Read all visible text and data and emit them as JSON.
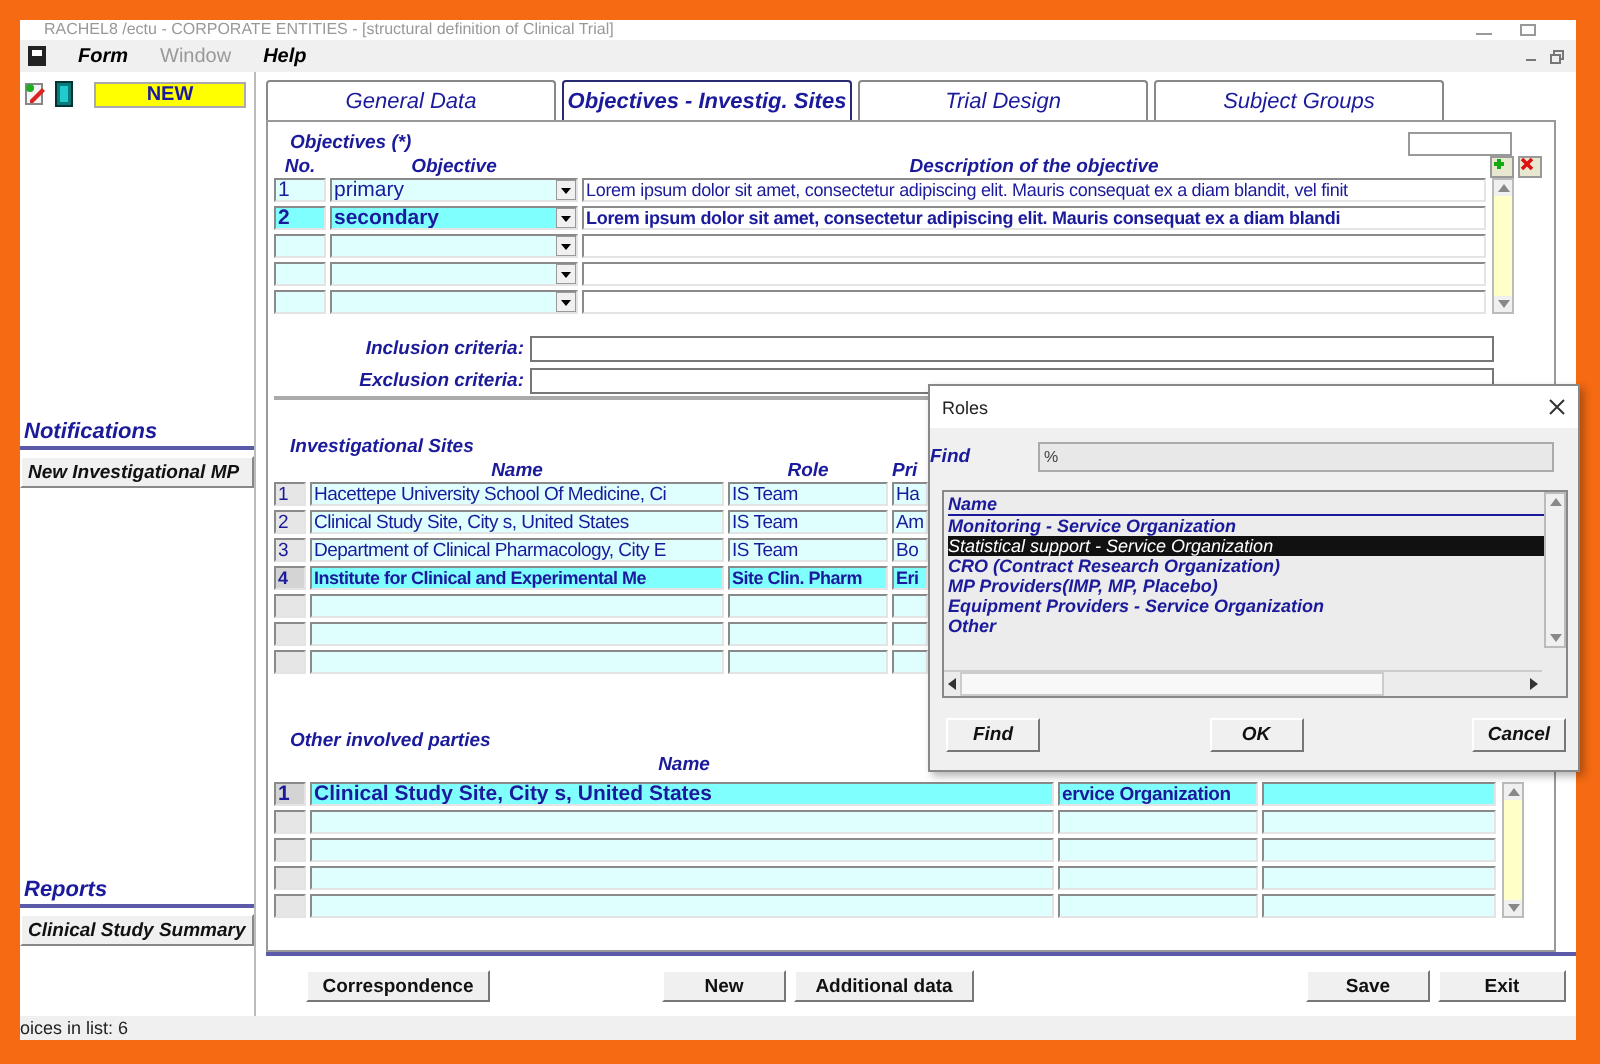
{
  "window": {
    "title": "RACHEL8 /ectu - CORPORATE ENTITIES - [structural definition of Clinical Trial]"
  },
  "menu": [
    {
      "label": "Form",
      "disabled": false
    },
    {
      "label": "Window",
      "disabled": true
    },
    {
      "label": "Help",
      "disabled": false
    }
  ],
  "sidebar": {
    "badge": "NEW",
    "sections": [
      {
        "title": "Notifications",
        "buttons": [
          "New Investigational MP"
        ]
      },
      {
        "title": "Reports",
        "buttons": [
          "Clinical Study Summary"
        ]
      }
    ]
  },
  "tabs": [
    {
      "label": "General Data",
      "selected": false
    },
    {
      "label": "Objectives -  Investig. Sites",
      "selected": true
    },
    {
      "label": "Trial Design",
      "selected": false
    },
    {
      "label": "Subject Groups",
      "selected": false
    }
  ],
  "objectives": {
    "title": "Objectives (*)",
    "columns": [
      "No.",
      "Objective",
      "Description of the objective"
    ],
    "rows": [
      {
        "no": "1",
        "objective": "primary",
        "description": "Lorem ipsum dolor sit amet, consectetur adipiscing elit. Mauris consequat ex a diam blandit, vel finit",
        "selected": false
      },
      {
        "no": "2",
        "objective": "secondary",
        "description": "Lorem ipsum dolor sit amet, consectetur adipiscing elit. Mauris consequat ex a diam blandi",
        "selected": true
      },
      {
        "selected": false
      },
      {
        "selected": false
      },
      {
        "selected": false
      }
    ],
    "criteria": [
      {
        "label": "Inclusion criteria:"
      },
      {
        "label": "Exclusion criteria:"
      }
    ]
  },
  "investigational_sites": {
    "title": "Investigational Sites",
    "columns": [
      "Name",
      "Role",
      "Pri"
    ],
    "rows": [
      {
        "no": "1",
        "name": "Hacettepe University School Of Medicine, Ci",
        "role": "IS Team",
        "column_3": "Ha",
        "selected": false
      },
      {
        "no": "2",
        "name": "Clinical Study Site, City s, United States",
        "role": "IS Team",
        "column_3": "Am",
        "selected": false
      },
      {
        "no": "3",
        "name": "Department of Clinical Pharmacology, City E",
        "role": "IS Team",
        "column_3": "Bo",
        "selected": false
      },
      {
        "no": "4",
        "name": "Institute for Clinical and Experimental Me",
        "role": "Site Clin. Pharm",
        "column_3": "Eri",
        "selected": true
      },
      {
        "selected": false
      },
      {
        "selected": false
      },
      {
        "selected": false
      }
    ]
  },
  "other_parties": {
    "title": "Other involved parties",
    "columns": [
      "Name"
    ],
    "rows": [
      {
        "no": "1",
        "name": "Clinical Study Site, City s, United States",
        "column_2": "ervice Organization",
        "selected": true
      },
      {
        "selected": false
      },
      {
        "selected": false
      },
      {
        "selected": false
      },
      {
        "selected": false
      }
    ]
  },
  "buttons": [
    "Correspondence",
    "New",
    "Additional data",
    "Save",
    "Exit"
  ],
  "status_bar": "oices in list: 6",
  "dialog": {
    "title": "Roles",
    "find_label": "Find",
    "find_value": "%",
    "list_header": "Name",
    "items": [
      {
        "label": "Monitoring - Service Organization",
        "selected": false
      },
      {
        "label": "Statistical support - Service Organization",
        "selected": true
      },
      {
        "label": "CRO (Contract Research Organization)",
        "selected": false
      },
      {
        "label": "MP Providers(IMP, MP, Placebo)",
        "selected": false
      },
      {
        "label": "Equipment Providers - Service Organization",
        "selected": false
      },
      {
        "label": "Other",
        "selected": false
      }
    ],
    "buttons": [
      "Find",
      "OK",
      "Cancel"
    ]
  }
}
